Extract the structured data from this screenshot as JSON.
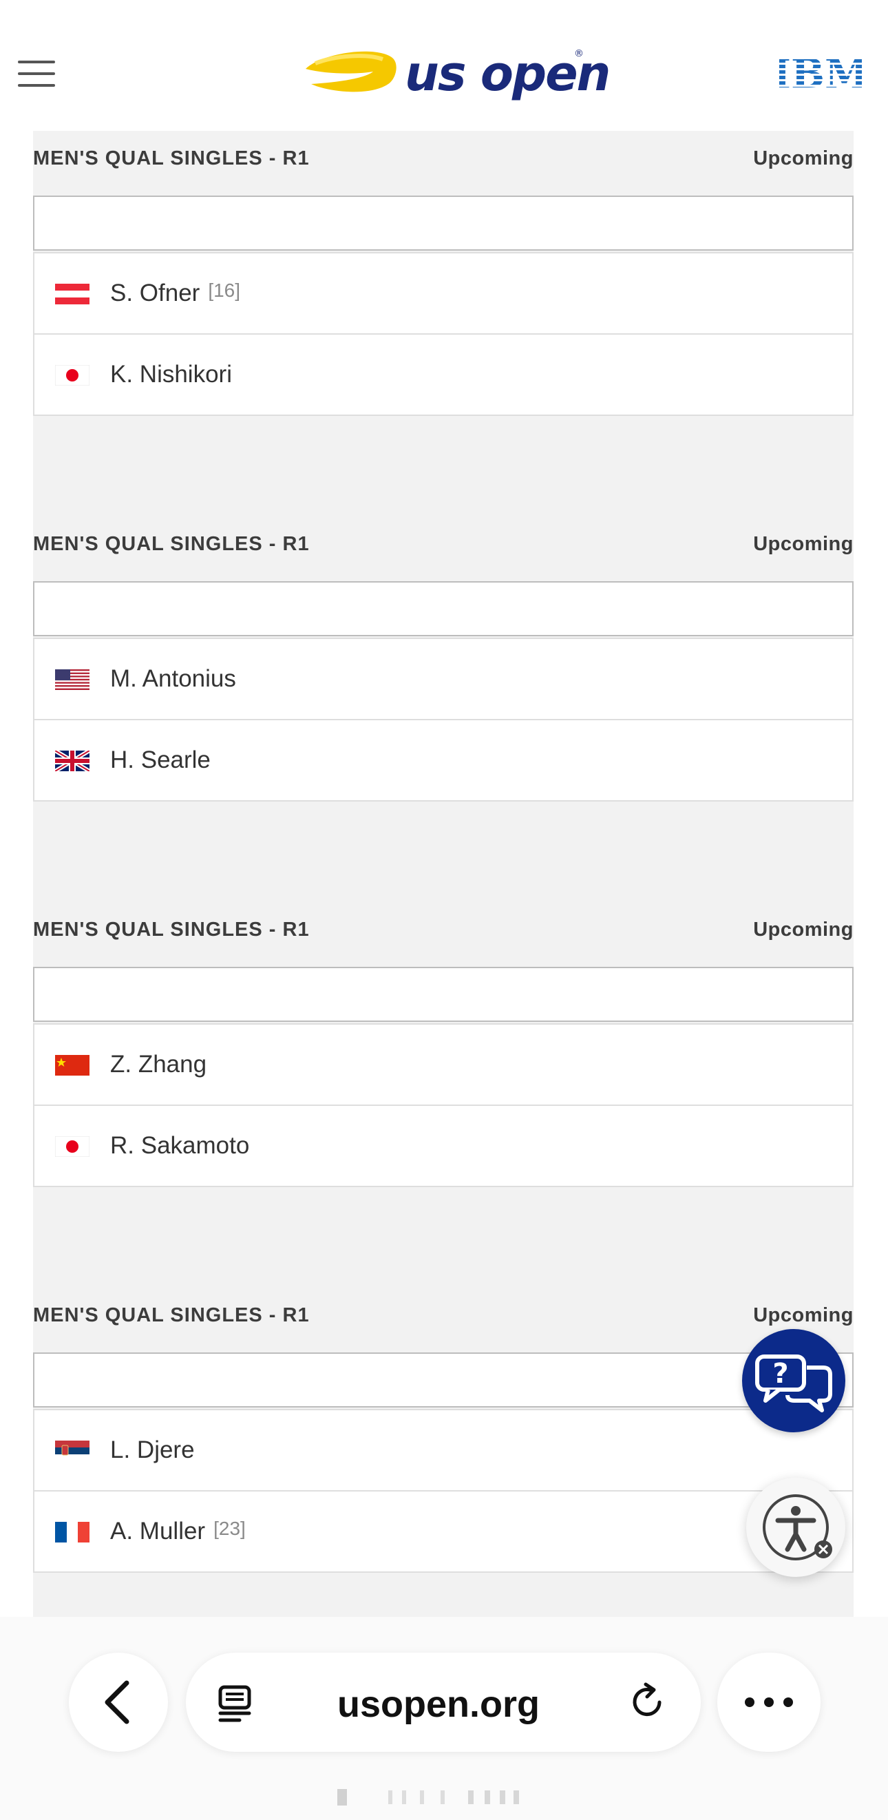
{
  "header": {
    "logo_text": "us open",
    "logo_reg": "®",
    "menu_icon": "hamburger-menu-icon",
    "sponsor": "IBM",
    "colors": {
      "brand_blue": "#1a2a7a",
      "brand_yellow": "#f5c800",
      "ibm_blue": "#1f70c1"
    }
  },
  "matches": [
    {
      "round": "MEN'S QUAL SINGLES - R1",
      "status": "Upcoming",
      "players": [
        {
          "name": "S. Ofner",
          "seed": "[16]",
          "flag": "austria"
        },
        {
          "name": "K. Nishikori",
          "seed": "",
          "flag": "japan"
        }
      ]
    },
    {
      "round": "MEN'S QUAL SINGLES - R1",
      "status": "Upcoming",
      "players": [
        {
          "name": "M. Antonius",
          "seed": "",
          "flag": "usa"
        },
        {
          "name": "H. Searle",
          "seed": "",
          "flag": "great-britain"
        }
      ]
    },
    {
      "round": "MEN'S QUAL SINGLES - R1",
      "status": "Upcoming",
      "players": [
        {
          "name": "Z. Zhang",
          "seed": "",
          "flag": "china"
        },
        {
          "name": "R. Sakamoto",
          "seed": "",
          "flag": "japan"
        }
      ]
    },
    {
      "round": "MEN'S QUAL SINGLES - R1",
      "status": "Upcoming",
      "players": [
        {
          "name": "L. Djere",
          "seed": "",
          "flag": "serbia"
        },
        {
          "name": "A. Muller",
          "seed": "[23]",
          "flag": "france"
        }
      ]
    }
  ],
  "floating": {
    "chat_icon": "chat-help-icon",
    "accessibility_icon": "accessibility-icon",
    "chat_color": "#0c2a8a"
  },
  "browser": {
    "url": "usopen.org",
    "back_icon": "chevron-left-icon",
    "reader_icon": "reader-mode-icon",
    "reload_icon": "reload-icon",
    "more_icon": "more-icon"
  }
}
